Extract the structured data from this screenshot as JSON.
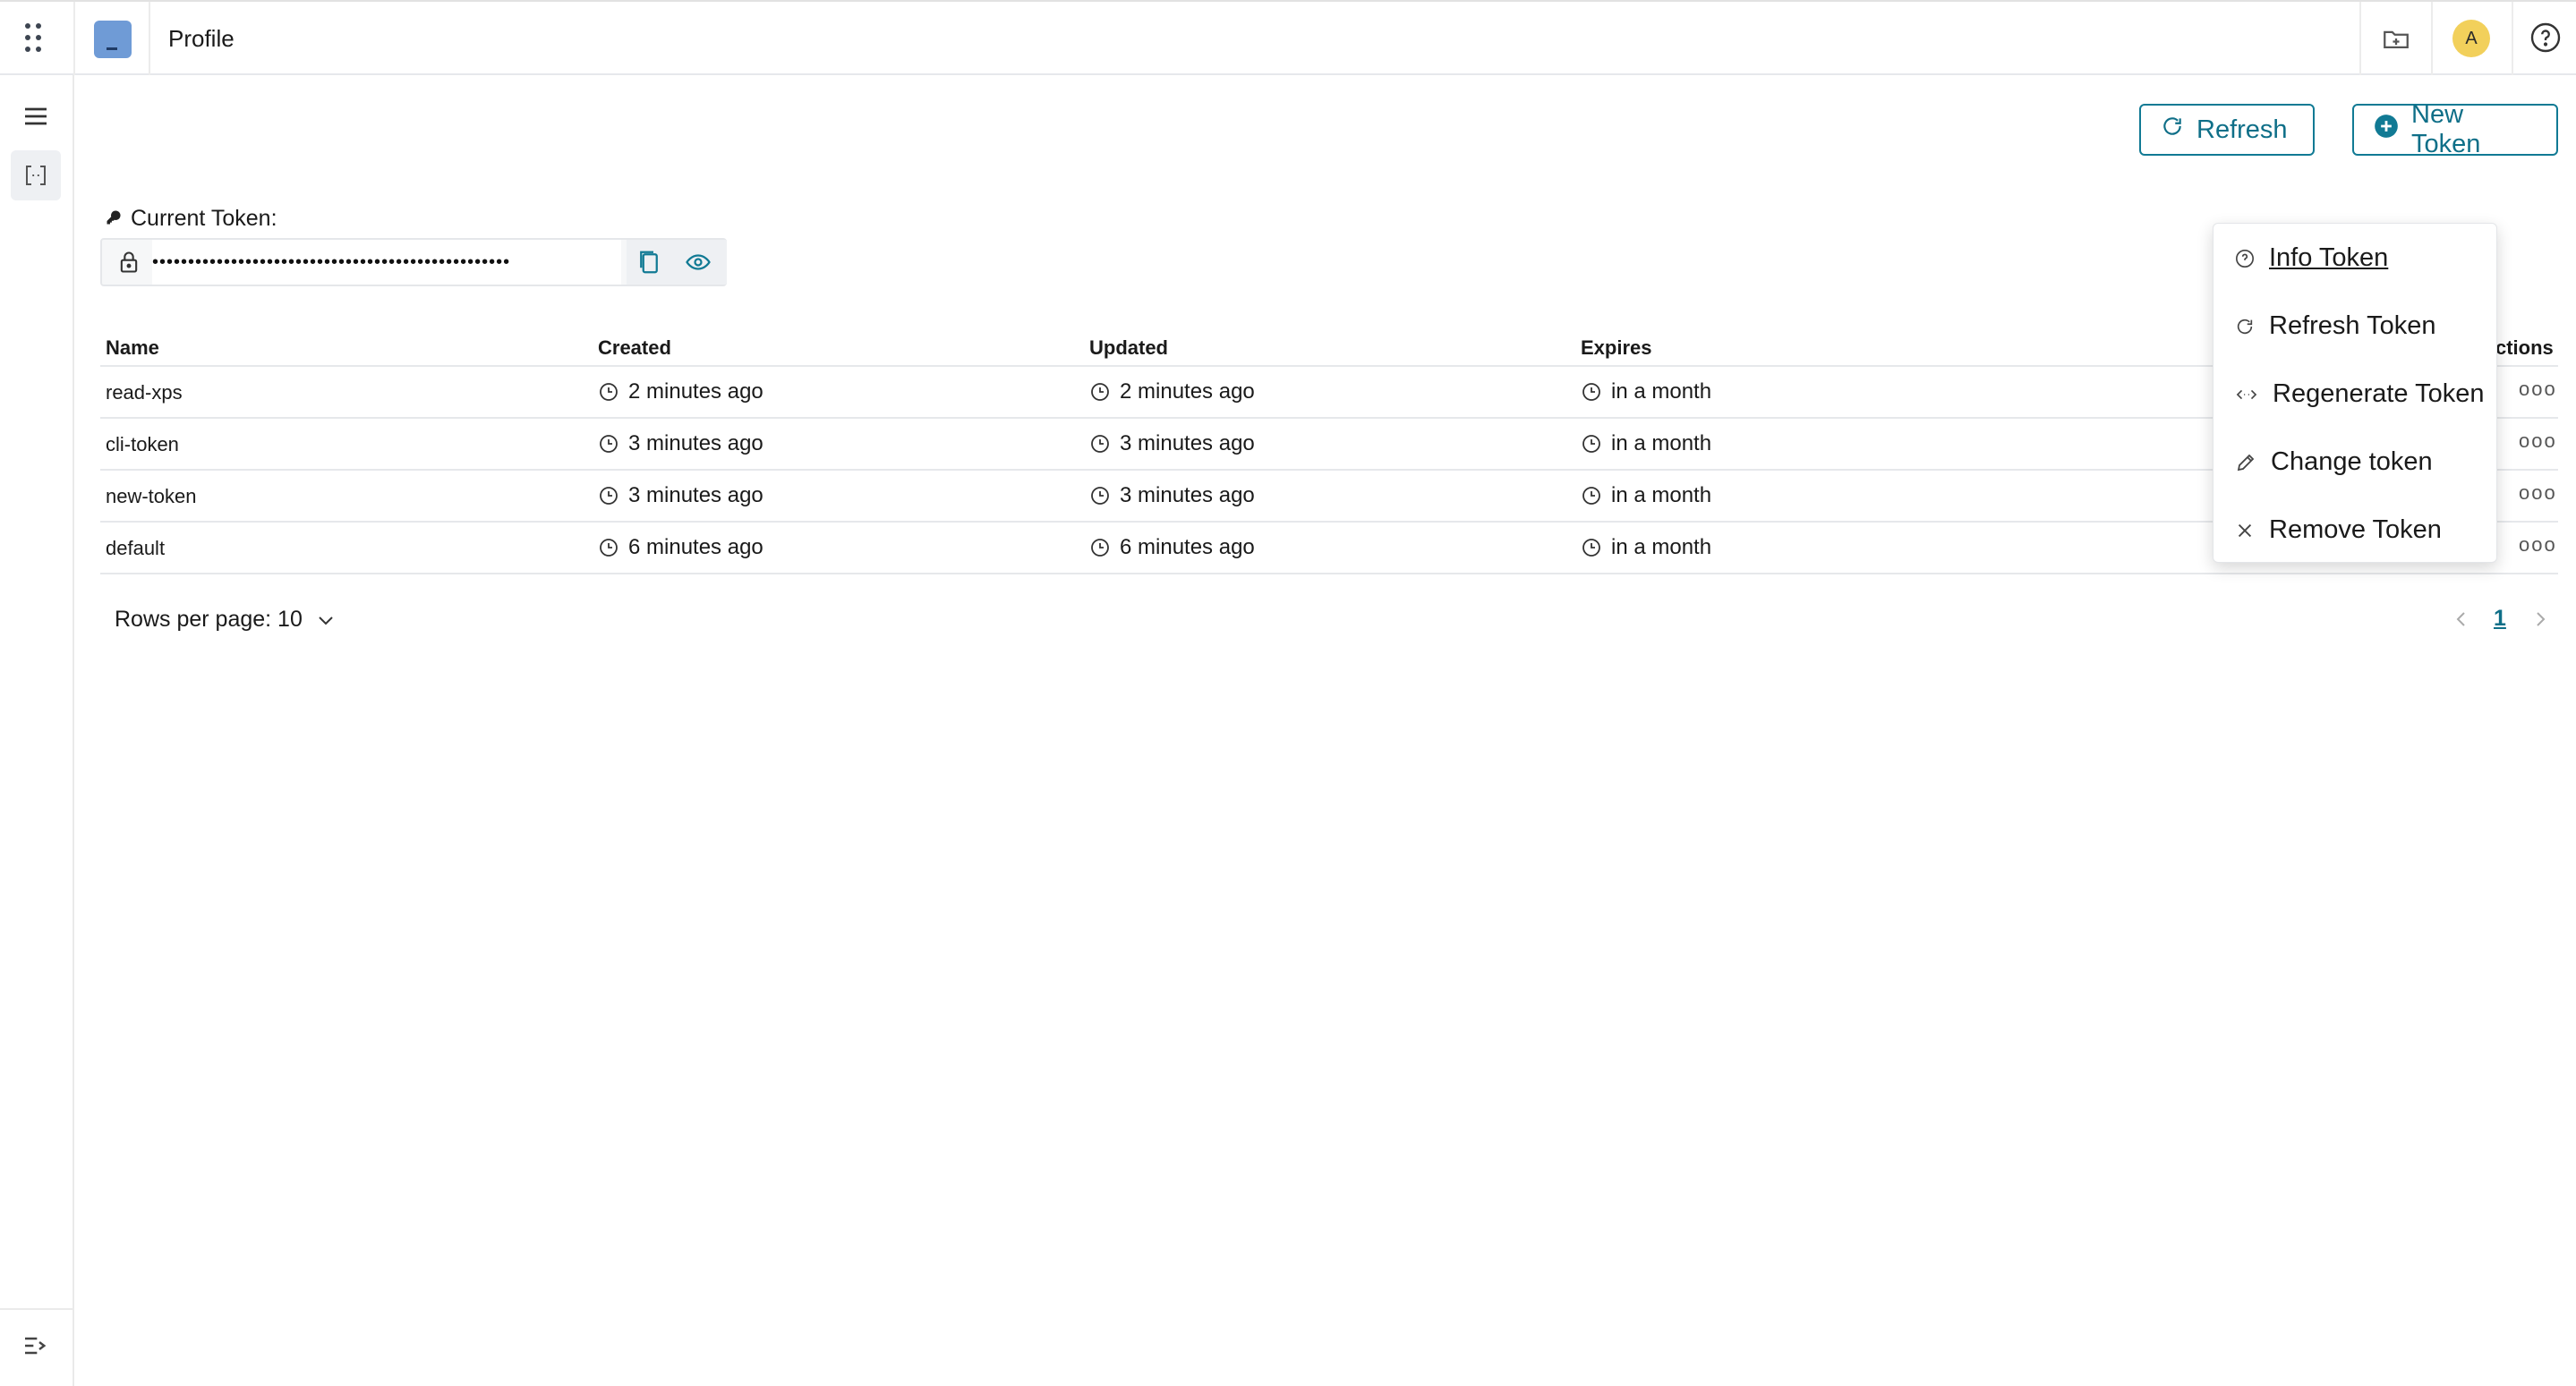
{
  "header": {
    "title": "Profile",
    "avatar_initial": "A",
    "icons": [
      "apps-grid-icon",
      "folder-plus-icon",
      "help-circle-icon"
    ]
  },
  "sidebar": {
    "icons": [
      "menu-icon",
      "code-bracket-icon",
      "expand-sidebar-icon"
    ]
  },
  "toolbar": {
    "refresh_label": "Refresh",
    "new_token_label": "New Token"
  },
  "token": {
    "label": "Current Token:",
    "masked_value": "••••••••••••••••••••••••••••••••••••••••••••••••••"
  },
  "table": {
    "columns": [
      "Name",
      "Created",
      "Updated",
      "Expires",
      "ctions"
    ],
    "rows": [
      {
        "name": "read-xps",
        "created": "2 minutes ago",
        "updated": "2 minutes ago",
        "expires": "in a month"
      },
      {
        "name": "cli-token",
        "created": "3 minutes ago",
        "updated": "3 minutes ago",
        "expires": "in a month"
      },
      {
        "name": "new-token",
        "created": "3 minutes ago",
        "updated": "3 minutes ago",
        "expires": "in a month"
      },
      {
        "name": "default",
        "created": "6 minutes ago",
        "updated": "6 minutes ago",
        "expires": "in a month"
      }
    ],
    "row_actions": "ooo"
  },
  "pagination": {
    "rows_per_page": "Rows per page: 10",
    "current_page": "1"
  },
  "menu": {
    "items": [
      {
        "label": "Info Token",
        "icon": "help-circle-icon"
      },
      {
        "label": "Refresh Token",
        "icon": "refresh-icon"
      },
      {
        "label": "Regenerate Token",
        "icon": "regenerate-icon"
      },
      {
        "label": "Change token",
        "icon": "pencil-icon"
      },
      {
        "label": "Remove Token",
        "icon": "close-icon"
      }
    ]
  },
  "colors": {
    "accent": "#117a94",
    "logo": "#6f9bd6",
    "avatar": "#f2d05b"
  }
}
